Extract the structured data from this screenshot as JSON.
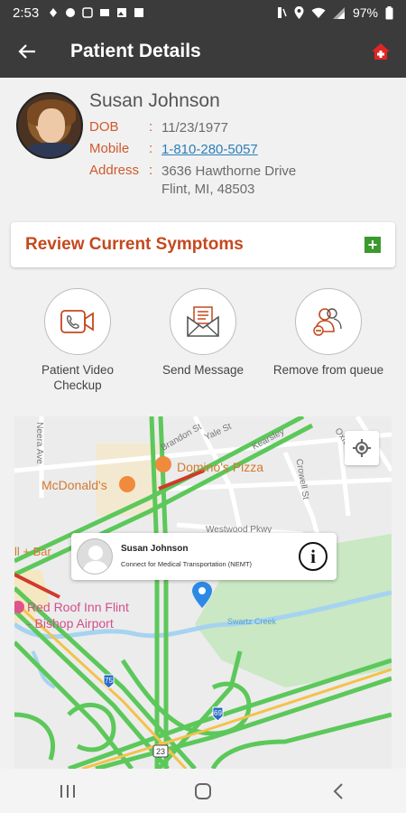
{
  "status_bar": {
    "time": "2:53",
    "battery": "97%"
  },
  "app_bar": {
    "title": "Patient Details"
  },
  "patient": {
    "name": "Susan Johnson",
    "dob_label": "DOB",
    "dob": "11/23/1977",
    "mobile_label": "Mobile",
    "mobile": "1-810-280-5057",
    "address_label": "Address",
    "address_line1": "3636 Hawthorne Drive",
    "address_line2": "Flint, MI, 48503",
    "separator": ":"
  },
  "symptoms": {
    "title": "Review Current Symptoms",
    "add_icon": "plus-icon"
  },
  "actions": [
    {
      "label": "Patient Video Checkup",
      "icon": "video-call-icon"
    },
    {
      "label": "Send Message",
      "icon": "envelope-icon"
    },
    {
      "label": "Remove from queue",
      "icon": "remove-user-icon"
    }
  ],
  "map": {
    "labels": {
      "brandon": "Brandon St",
      "yale": "Yale St",
      "kearsley": "Kearsley",
      "oxford": "Oxford St",
      "crowell": "Crowell St",
      "neera": "Neera Ave",
      "mcdonalds": "McDonald's",
      "dominos": "Domino's Pizza",
      "westwood": "Westwood Pkwy",
      "bar": "ll + Bar",
      "redroof": "Red Roof Inn Flint",
      "bishop": "- Bishop Airport",
      "swartz": "Swartz Creek",
      "hwy69": "69",
      "hwy75": "75",
      "hwy23": "23"
    },
    "popup": {
      "name": "Susan Johnson",
      "subtitle": "Connect for Medical Transportation (NEMT)"
    }
  },
  "colors": {
    "bar": "#3b3b3b",
    "accent": "#c4491e",
    "label": "#cf5a2e",
    "link": "#2c7fb8",
    "road": "#5cc85a",
    "plus": "#3a9a2e"
  }
}
